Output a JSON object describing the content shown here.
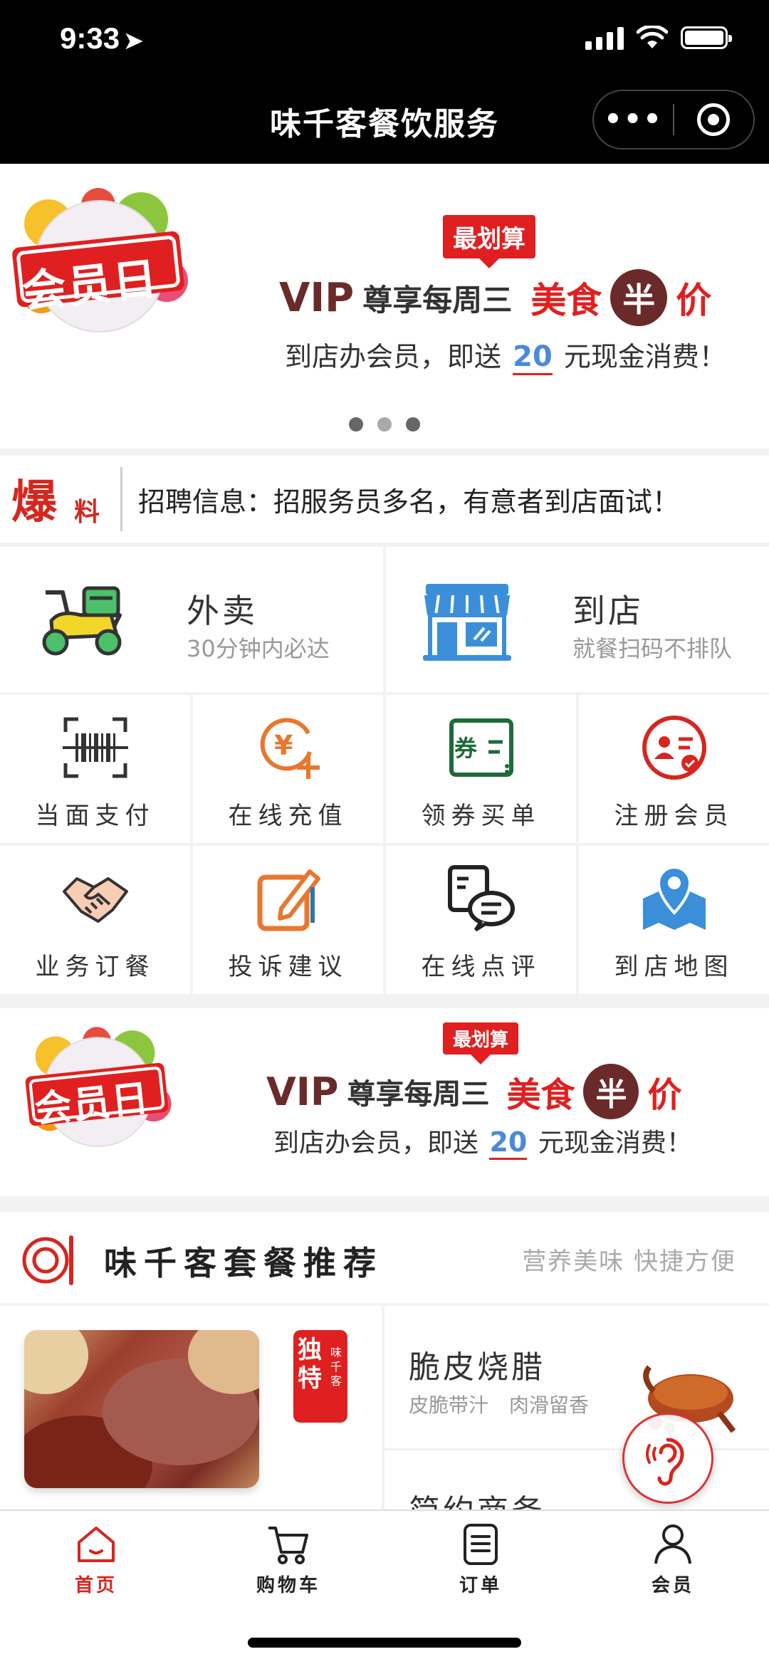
{
  "status_bar": {
    "time": "9:33"
  },
  "nav": {
    "title": "味千客餐饮服务",
    "more_label": "•••"
  },
  "banner": {
    "logo_text": "会员日",
    "tag": "最划算",
    "vip": "VIP",
    "line_prefix": "尊享每周三",
    "food": "美食",
    "half": "半",
    "price": "价",
    "sub_prefix": "到店办会员，即送",
    "sub_amount": "20",
    "sub_suffix": "元现金消费！"
  },
  "notice": {
    "badge_big": "爆",
    "badge_small": "料",
    "text": "招聘信息：招服务员多名，有意者到店面试！"
  },
  "big_cards": [
    {
      "title": "外卖",
      "subtitle": "30分钟内必达",
      "icon": "scooter-icon"
    },
    {
      "title": "到店",
      "subtitle": "就餐扫码不排队",
      "icon": "storefront-icon"
    }
  ],
  "grid": [
    {
      "label": "当面支付",
      "icon": "barcode-scan-icon"
    },
    {
      "label": "在线充值",
      "icon": "yen-recharge-icon"
    },
    {
      "label": "领券买单",
      "icon": "coupon-icon"
    },
    {
      "label": "注册会员",
      "icon": "member-card-icon"
    },
    {
      "label": "业务订餐",
      "icon": "handshake-icon"
    },
    {
      "label": "投诉建议",
      "icon": "edit-note-icon"
    },
    {
      "label": "在线点评",
      "icon": "review-chat-icon"
    },
    {
      "label": "到店地图",
      "icon": "map-pin-icon"
    }
  ],
  "section": {
    "title": "味千客套餐推荐",
    "tagline": "营养美味  快捷方便"
  },
  "products": {
    "left_tag_main": "独特",
    "left_tag_small": "味千客",
    "item1_title": "脆皮烧腊",
    "item1_sub": "皮脆带汁 肉滑留香",
    "item2_title": "简约商务"
  },
  "tabbar": [
    {
      "label": "首页",
      "icon": "home-icon",
      "active": true
    },
    {
      "label": "购物车",
      "icon": "cart-icon",
      "active": false
    },
    {
      "label": "订单",
      "icon": "order-list-icon",
      "active": false
    },
    {
      "label": "会员",
      "icon": "user-icon",
      "active": false
    }
  ],
  "colors": {
    "accent": "#e02020",
    "vip_brown": "#6b2a2a",
    "highlight_blue": "#4a8ad8"
  }
}
